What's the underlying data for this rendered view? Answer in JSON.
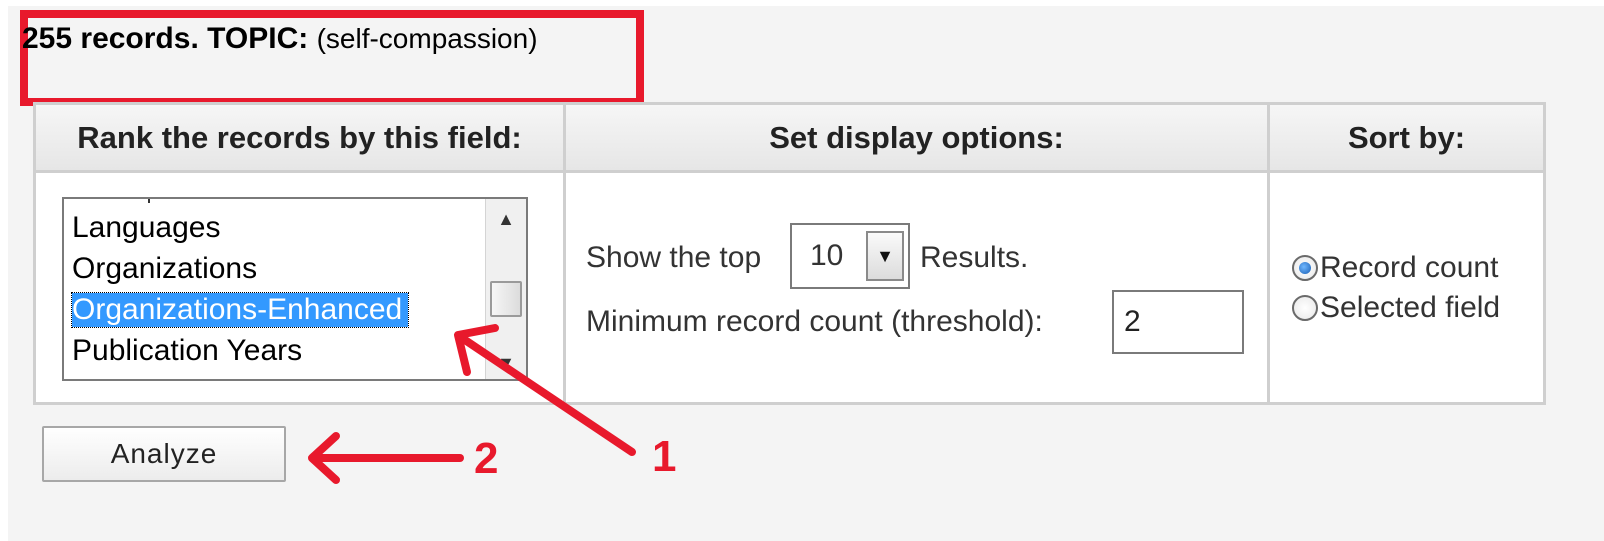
{
  "header": {
    "summary": "255 records. TOPIC:",
    "topic_value": "(self-compassion)"
  },
  "columns": {
    "rank_field": "Rank the records by this field:",
    "display_options": "Set display options:",
    "sort_by": "Sort by:"
  },
  "field_list": {
    "items": [
      "Languages",
      "Organizations",
      "Organizations-Enhanced",
      "Publication Years"
    ],
    "selected": "Organizations-Enhanced"
  },
  "display": {
    "show_top_label": "Show the top",
    "show_top_value": "10",
    "results_label": "Results.",
    "threshold_label": "Minimum record count (threshold):",
    "threshold_value": "2"
  },
  "sort": {
    "options": [
      "Record count",
      "Selected field"
    ],
    "selected": "Record count"
  },
  "actions": {
    "analyze_label": "Analyze"
  },
  "annotations": {
    "step1": "1",
    "step2": "2",
    "color": "#e8192c"
  }
}
